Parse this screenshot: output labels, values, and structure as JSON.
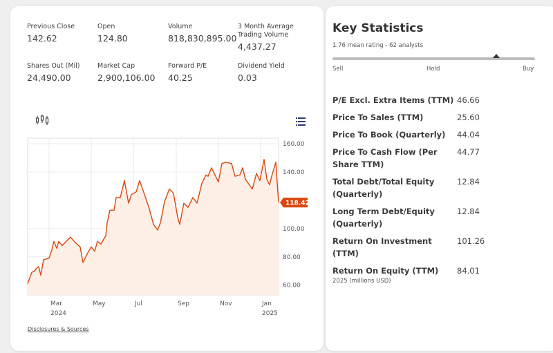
{
  "quote_stats": [
    {
      "label": "Previous Close",
      "value": "142.62"
    },
    {
      "label": "Open",
      "value": "124.80"
    },
    {
      "label": "Volume",
      "value": "818,830,895.00"
    },
    {
      "label": "3 Month Average Trading Volume",
      "value": "4,437.27"
    },
    {
      "label": "Shares Out (Mil)",
      "value": "24,490.00"
    },
    {
      "label": "Market Cap",
      "value": "2,900,106.00"
    },
    {
      "label": "Forward P/E",
      "value": "40.25"
    },
    {
      "label": "Dividend Yield",
      "value": "0.03"
    }
  ],
  "chart_toolbar": {
    "left_icon": "candlestick-chart-icon",
    "right_icon": "list-icon"
  },
  "chart_data": {
    "type": "area",
    "line_color": "#d9480f",
    "fill_color": "#fdeee6",
    "current_value_label": "118.42",
    "ylim": [
      53,
      164
    ],
    "yticks": [
      "160.00",
      "140.00",
      "100.00",
      "80.00",
      "60.00"
    ],
    "ytick_values": [
      160,
      140,
      100,
      80,
      60
    ],
    "xticks": [
      {
        "date": "2024-03-01",
        "label": "Mar",
        "sub": "2024"
      },
      {
        "date": "2024-05-01",
        "label": "May",
        "sub": ""
      },
      {
        "date": "2024-07-01",
        "label": "Jul",
        "sub": ""
      },
      {
        "date": "2024-09-01",
        "label": "Sep",
        "sub": ""
      },
      {
        "date": "2024-11-01",
        "label": "Nov",
        "sub": ""
      },
      {
        "date": "2025-01-01",
        "label": "Jan",
        "sub": "2025"
      }
    ],
    "xlim": [
      "2024-01-30",
      "2025-01-27"
    ],
    "grid": true,
    "points": [
      [
        "2024-01-30",
        61
      ],
      [
        "2024-02-05",
        69
      ],
      [
        "2024-02-09",
        70
      ],
      [
        "2024-02-12",
        72
      ],
      [
        "2024-02-15",
        73
      ],
      [
        "2024-02-18",
        67
      ],
      [
        "2024-02-22",
        78
      ],
      [
        "2024-03-01",
        79
      ],
      [
        "2024-03-05",
        85
      ],
      [
        "2024-03-08",
        91
      ],
      [
        "2024-03-12",
        86
      ],
      [
        "2024-03-15",
        91
      ],
      [
        "2024-03-20",
        88
      ],
      [
        "2024-04-01",
        94
      ],
      [
        "2024-04-08",
        90
      ],
      [
        "2024-04-15",
        87
      ],
      [
        "2024-04-19",
        76
      ],
      [
        "2024-04-25",
        82
      ],
      [
        "2024-05-01",
        87
      ],
      [
        "2024-05-06",
        84
      ],
      [
        "2024-05-10",
        91
      ],
      [
        "2024-05-15",
        89
      ],
      [
        "2024-05-22",
        95
      ],
      [
        "2024-05-24",
        104
      ],
      [
        "2024-05-28",
        113
      ],
      [
        "2024-06-03",
        113
      ],
      [
        "2024-06-06",
        122
      ],
      [
        "2024-06-12",
        122
      ],
      [
        "2024-06-18",
        134
      ],
      [
        "2024-06-24",
        118
      ],
      [
        "2024-06-28",
        124
      ],
      [
        "2024-07-05",
        126
      ],
      [
        "2024-07-10",
        134
      ],
      [
        "2024-07-15",
        127
      ],
      [
        "2024-07-24",
        114
      ],
      [
        "2024-07-30",
        103
      ],
      [
        "2024-08-05",
        99
      ],
      [
        "2024-08-09",
        104
      ],
      [
        "2024-08-15",
        119
      ],
      [
        "2024-08-22",
        128
      ],
      [
        "2024-08-28",
        125
      ],
      [
        "2024-09-03",
        108
      ],
      [
        "2024-09-06",
        103
      ],
      [
        "2024-09-12",
        118
      ],
      [
        "2024-09-18",
        115
      ],
      [
        "2024-09-25",
        122
      ],
      [
        "2024-10-01",
        118
      ],
      [
        "2024-10-08",
        132
      ],
      [
        "2024-10-14",
        138
      ],
      [
        "2024-10-17",
        137
      ],
      [
        "2024-10-22",
        143
      ],
      [
        "2024-10-28",
        137
      ],
      [
        "2024-11-01",
        133
      ],
      [
        "2024-11-06",
        146
      ],
      [
        "2024-11-12",
        147
      ],
      [
        "2024-11-20",
        146
      ],
      [
        "2024-11-25",
        137
      ],
      [
        "2024-12-02",
        138
      ],
      [
        "2024-12-06",
        143
      ],
      [
        "2024-12-10",
        135
      ],
      [
        "2024-12-17",
        130
      ],
      [
        "2024-12-20",
        128
      ],
      [
        "2024-12-26",
        139
      ],
      [
        "2024-12-31",
        134
      ],
      [
        "2025-01-06",
        149
      ],
      [
        "2025-01-10",
        135
      ],
      [
        "2025-01-14",
        131
      ],
      [
        "2025-01-17",
        137
      ],
      [
        "2025-01-23",
        147
      ],
      [
        "2025-01-27",
        118.42
      ]
    ]
  },
  "disclosures_link": "Disclosures & Sources",
  "key_stats": {
    "title": "Key Statistics",
    "rating_text": "1.76 mean rating - 62 analysts",
    "rating_marker_fraction": 0.81,
    "scale": {
      "sell": "Sell",
      "hold": "Hold",
      "buy": "Buy"
    },
    "rows": [
      {
        "label": "P/E Excl. Extra Items (TTM)",
        "value": "46.66"
      },
      {
        "label": "Price To Sales (TTM)",
        "value": "25.60"
      },
      {
        "label": "Price To Book (Quarterly)",
        "value": "44.04"
      },
      {
        "label": "Price To Cash Flow (Per Share TTM)",
        "value": "44.77"
      },
      {
        "label": "Total Debt/Total Equity (Quarterly)",
        "value": "12.84"
      },
      {
        "label": "Long Term Debt/Equity (Quarterly)",
        "value": "12.84"
      },
      {
        "label": "Return On Investment (TTM)",
        "value": "101.26"
      },
      {
        "label": "Return On Equity (TTM)",
        "value": "84.01"
      }
    ],
    "note": "2025 (millions USD)"
  }
}
